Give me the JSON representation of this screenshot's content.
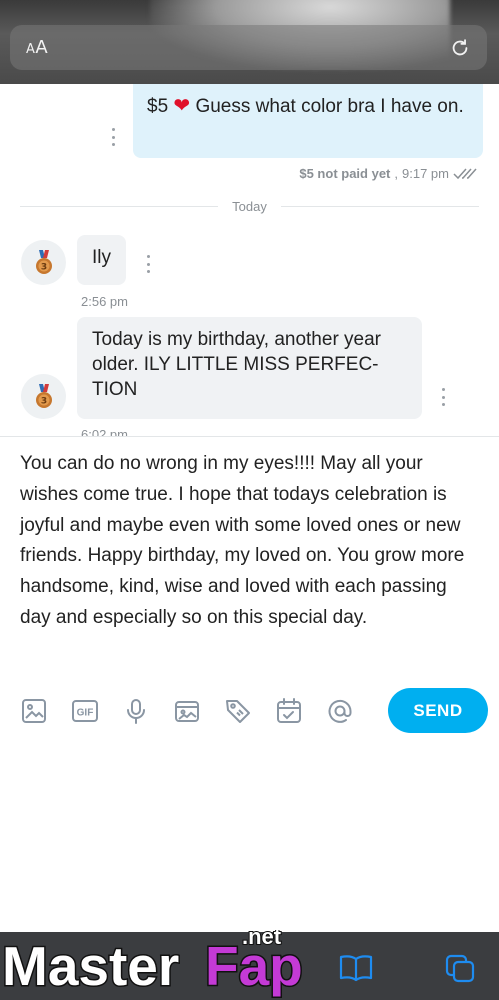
{
  "browser": {
    "text_size_label_small": "A",
    "text_size_label_large": "A"
  },
  "chat": {
    "outgoing": {
      "price": "$5",
      "text": " Guess what color bra I have on.",
      "status_unpaid": "$5 not paid yet",
      "status_sep": " , ",
      "time": "9:17 pm"
    },
    "date_divider": "Today",
    "incoming": [
      {
        "text": "Ily",
        "time": "2:56 pm"
      },
      {
        "text": "Today is my birthday, another year older. ILY LITTLE MISS PERFEC-TION",
        "time": "6:02 pm"
      }
    ]
  },
  "composer": {
    "text": "You can do no wrong in my eyes!!!! May all your wishes come true. I hope that todays celebration is joyful and maybe even with some loved ones or new friends. Happy birthday, my loved on. You grow more handsome, kind, wise and loved with each passing day and especially so on this special day."
  },
  "toolbar": {
    "gif_label": "GIF",
    "send_label": "SEND",
    "icons": [
      "image-icon",
      "gif-icon",
      "microphone-icon",
      "media-vault-icon",
      "price-tag-icon",
      "calendar-icon",
      "mention-icon"
    ]
  },
  "watermark": {
    "brand_white": "Master",
    "brand_color": "Fap",
    "tld": ".net"
  },
  "colors": {
    "accent": "#00aff0",
    "outgoing_bubble": "#dff2fb",
    "incoming_bubble": "#f0f2f4",
    "heart": "#e0112b",
    "bottom_bar": "#3b3d40"
  }
}
